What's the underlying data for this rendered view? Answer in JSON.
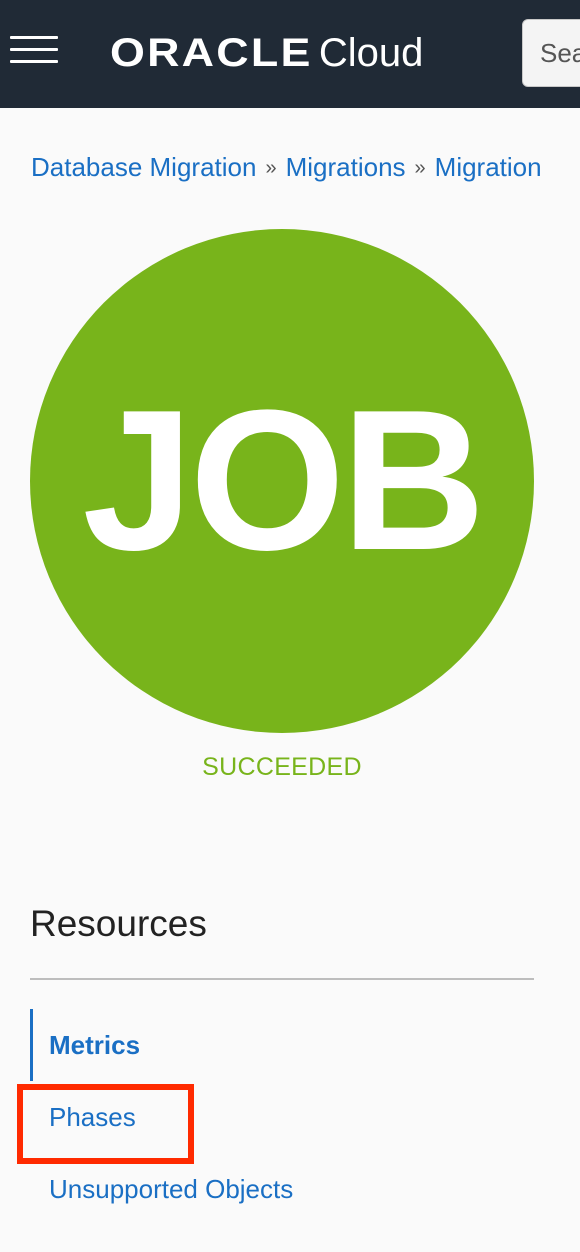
{
  "header": {
    "brand_oracle": "ORACLE",
    "brand_cloud": "Cloud",
    "search_placeholder": "Search"
  },
  "breadcrumb": {
    "items": [
      "Database Migration",
      "Migrations",
      "Migration"
    ],
    "separator": "»"
  },
  "job": {
    "icon_text": "JOB",
    "status": "SUCCEEDED",
    "color": "#78b41b"
  },
  "resources": {
    "title": "Resources",
    "items": [
      {
        "label": "Metrics",
        "active": true
      },
      {
        "label": "Phases",
        "active": false
      },
      {
        "label": "Unsupported Objects",
        "active": false
      }
    ]
  },
  "colors": {
    "header_bg": "#202a36",
    "link": "#1a6fc4",
    "highlight": "#ff2a00"
  }
}
